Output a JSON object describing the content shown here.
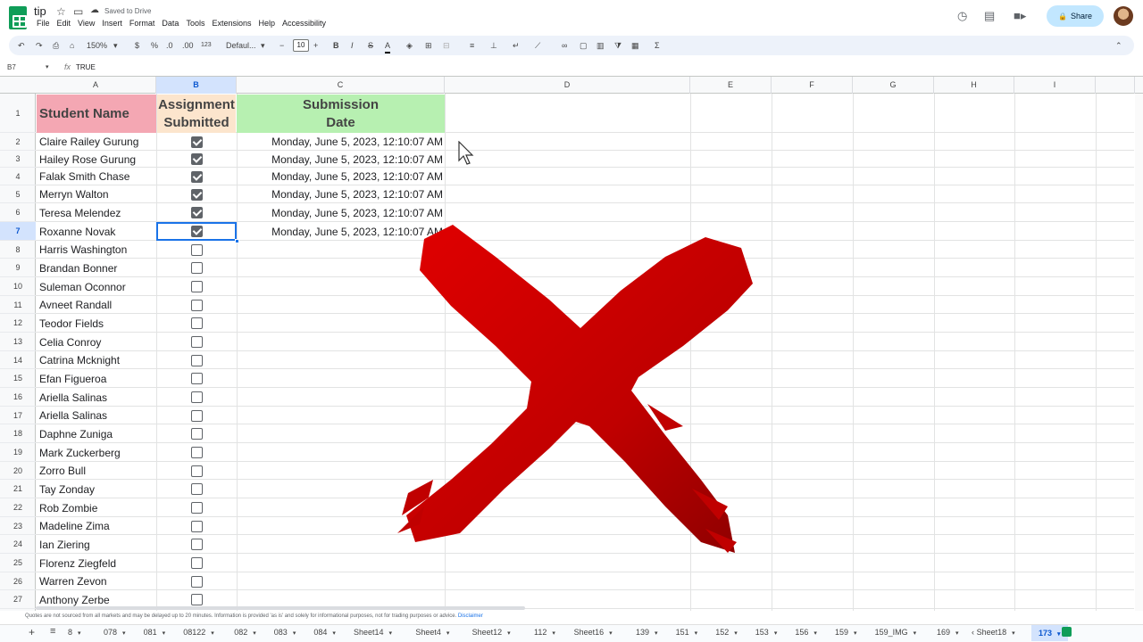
{
  "app": {
    "title": "tip",
    "saved": "Saved to Drive",
    "share": "Share",
    "menu": [
      "File",
      "Edit",
      "View",
      "Insert",
      "Format",
      "Data",
      "Tools",
      "Extensions",
      "Help",
      "Accessibility"
    ]
  },
  "toolbar": {
    "zoom": "150%",
    "currency": "$",
    "percent": "%",
    "dec_less": ".0",
    "dec_more": ".00",
    "number_fmt": "123",
    "font": "Defaul...",
    "font_size": "10",
    "bold": "B",
    "italic": "I",
    "strike": "S",
    "color": "A",
    "sigma": "Σ"
  },
  "formula_bar": {
    "cell_ref": "B7",
    "fx": "fx",
    "value": "TRUE"
  },
  "columns": [
    "A",
    "B",
    "C",
    "D",
    "E",
    "F",
    "G",
    "H",
    "I"
  ],
  "headers": {
    "a": "Student Name",
    "b": "Assignment Submitted",
    "c": "Submission Date"
  },
  "rows": [
    {
      "n": "1"
    },
    {
      "n": "2",
      "name": "Claire Railey Gurung",
      "checked": true,
      "date": "Monday, June 5, 2023, 12:10:07 AM"
    },
    {
      "n": "3",
      "name": "Hailey Rose Gurung",
      "checked": true,
      "date": "Monday, June 5, 2023, 12:10:07 AM"
    },
    {
      "n": "4",
      "name": "Falak Smith Chase",
      "checked": true,
      "date": "Monday, June 5, 2023, 12:10:07 AM"
    },
    {
      "n": "5",
      "name": "Merryn Walton",
      "checked": true,
      "date": "Monday, June 5, 2023, 12:10:07 AM"
    },
    {
      "n": "6",
      "name": "Teresa Melendez",
      "checked": true,
      "date": "Monday, June 5, 2023, 12:10:07 AM"
    },
    {
      "n": "7",
      "name": "Roxanne Novak",
      "checked": true,
      "date": "Monday, June 5, 2023, 12:10:07 AM"
    },
    {
      "n": "8",
      "name": "Harris Washington",
      "checked": false,
      "date": ""
    },
    {
      "n": "9",
      "name": "Brandan Bonner",
      "checked": false,
      "date": ""
    },
    {
      "n": "10",
      "name": "Suleman Oconnor",
      "checked": false,
      "date": ""
    },
    {
      "n": "11",
      "name": "Avneet Randall",
      "checked": false,
      "date": ""
    },
    {
      "n": "12",
      "name": "Teodor Fields",
      "checked": false,
      "date": ""
    },
    {
      "n": "13",
      "name": "Celia Conroy",
      "checked": false,
      "date": ""
    },
    {
      "n": "14",
      "name": "Catrina Mcknight",
      "checked": false,
      "date": ""
    },
    {
      "n": "15",
      "name": "Efan Figueroa",
      "checked": false,
      "date": ""
    },
    {
      "n": "16",
      "name": "Ariella Salinas",
      "checked": false,
      "date": ""
    },
    {
      "n": "17",
      "name": "Ariella Salinas",
      "checked": false,
      "date": ""
    },
    {
      "n": "18",
      "name": "Daphne Zuniga",
      "checked": false,
      "date": ""
    },
    {
      "n": "19",
      "name": "Mark Zuckerberg",
      "checked": false,
      "date": ""
    },
    {
      "n": "20",
      "name": "Zorro Bull",
      "checked": false,
      "date": ""
    },
    {
      "n": "21",
      "name": "Tay Zonday",
      "checked": false,
      "date": ""
    },
    {
      "n": "22",
      "name": "Rob Zombie",
      "checked": false,
      "date": ""
    },
    {
      "n": "23",
      "name": "Madeline Zima",
      "checked": false,
      "date": ""
    },
    {
      "n": "24",
      "name": "Ian Ziering",
      "checked": false,
      "date": ""
    },
    {
      "n": "25",
      "name": "Florenz Ziegfeld",
      "checked": false,
      "date": ""
    },
    {
      "n": "26",
      "name": "Warren Zevon",
      "checked": false,
      "date": ""
    },
    {
      "n": "27",
      "name": "Anthony Zerbe",
      "checked": false,
      "date": ""
    }
  ],
  "footer": {
    "disclaimer": "Quotes are not sourced from all markets and may be delayed up to 20 minutes. Information is provided 'as is' and solely for informational purposes, not for trading purposes or advice.",
    "disclaimer_link": "Disclaimer"
  },
  "sheets": [
    "8",
    "078",
    "081",
    "08122",
    "082",
    "083",
    "084",
    "Sheet14",
    "Sheet4",
    "Sheet12",
    "112",
    "Sheet16",
    "139",
    "151",
    "152",
    "153",
    "156",
    "159",
    "159_IMG",
    "169",
    "Sheet18",
    "173"
  ],
  "active_sheet": "173",
  "colors": {
    "header_a": "#f4a7b3",
    "header_b": "#fce5cd",
    "header_c": "#b7f0b1",
    "selection": "#1a73e8",
    "x_mark": "#c00000"
  }
}
